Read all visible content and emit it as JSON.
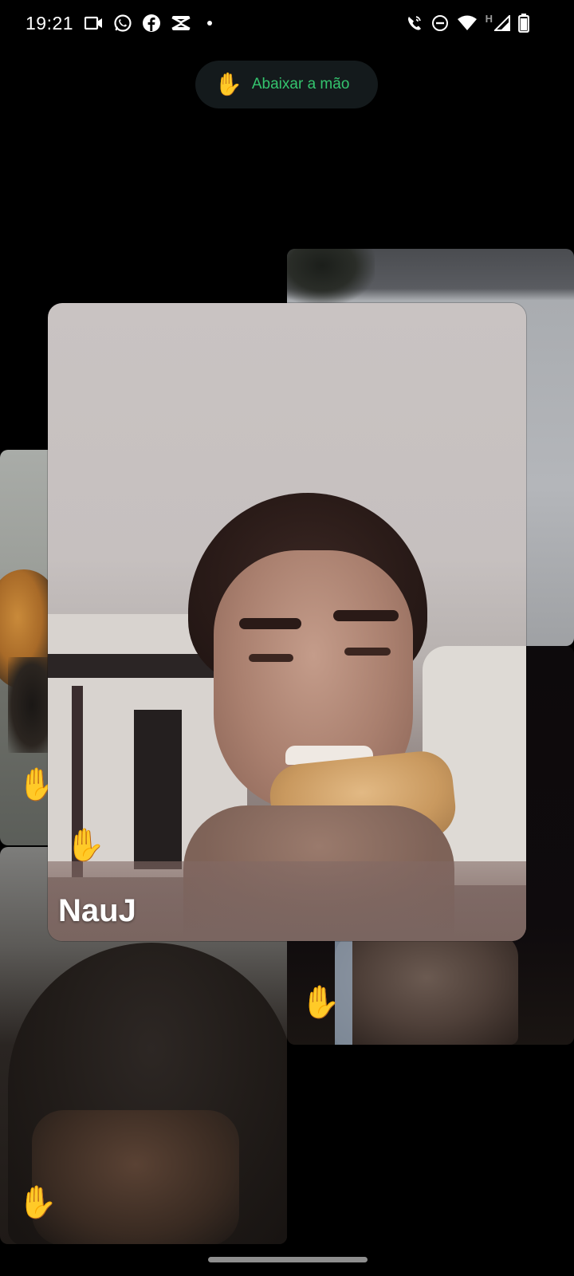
{
  "status_bar": {
    "time": "19:21",
    "left_icons": [
      "video-camera-icon",
      "whatsapp-icon",
      "facebook-icon",
      "capcut-icon",
      "notification-dot-icon"
    ],
    "right_icons": [
      "wifi-calling-icon",
      "do-not-disturb-icon",
      "wifi-icon",
      "signal-icon",
      "battery-icon"
    ],
    "network_letter": "H"
  },
  "call": {
    "lower_hand_label": "Abaixar a mão",
    "accent_color": "#34c46e",
    "raised_hand_icon": "✋",
    "active_participant_name": "NauJ",
    "participants_with_raised_hand": 4
  }
}
